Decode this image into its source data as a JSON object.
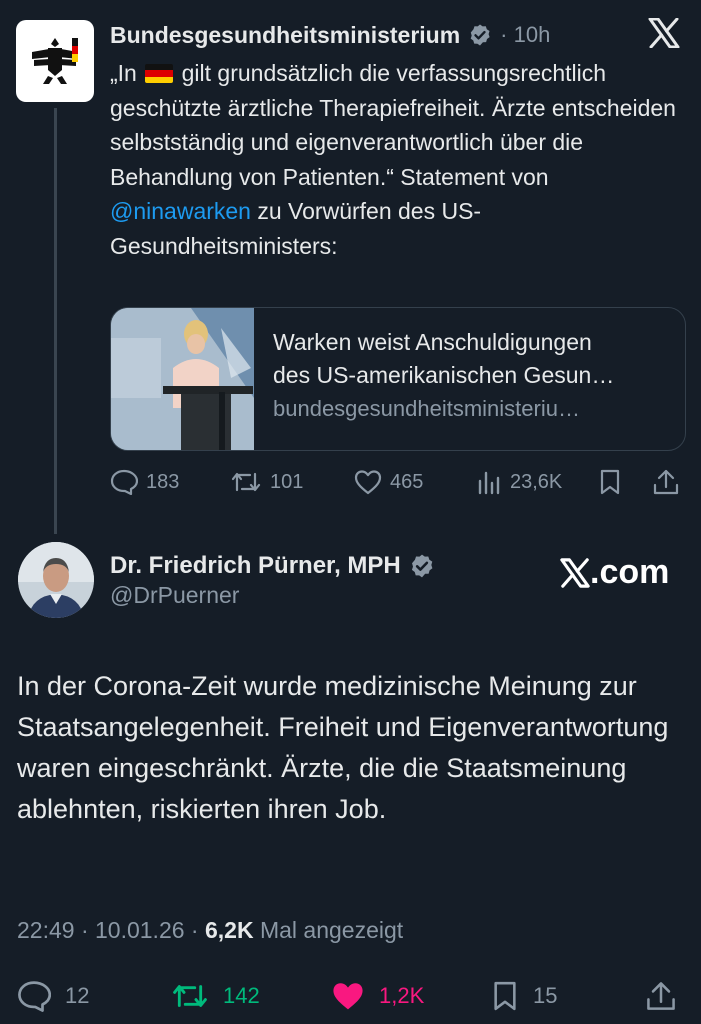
{
  "quoted": {
    "name": "Bundesgesundheitsministerium",
    "time": "· 10h",
    "text_a": "„In",
    "text_b": " gilt grundsätzlich die verfassungsrechtlich geschützte ärztliche Therapiefreiheit. Ärzte entscheiden selbstständig und eigenverantwortlich über die Behandlung von Patienten.“ Statement von ",
    "mention": "@ninawarken",
    "text_c": " zu Vorwürfen des US-Gesundheitsministers:",
    "card": {
      "title_line1": "Warken weist Anschuldigungen",
      "title_line2": "des US-amerikanischen Gesun…",
      "domain": "bundesgesundheitsministeriu…"
    },
    "stats": {
      "replies": "183",
      "reposts": "101",
      "likes": "465",
      "views": "23,6K"
    }
  },
  "main": {
    "name": "Dr. Friedrich Pürner, MPH",
    "handle": "@DrPuerner",
    "watermark": ".com",
    "text": "In der Corona-Zeit wurde medizinische Meinung zur Staatsangelegenheit. Freiheit und Eigenverantwortung waren eingeschränkt. Ärzte, die die Staatsmeinung ablehnten, riskierten ihren Job.",
    "meta_time": "22:49 · 10.01.26 · ",
    "meta_views": "6,2K",
    "meta_suffix": " Mal angezeigt",
    "stats": {
      "replies": "12",
      "reposts": "142",
      "likes": "1,2K",
      "bookmarks": "15"
    }
  },
  "colors": {
    "background": "#151d27",
    "mention": "#1d9bf0",
    "repost_active": "#00ba7c",
    "like_active": "#f91880",
    "verified": "#8b98a5"
  },
  "icons": [
    "eagle-logo-icon",
    "verified-icon",
    "x-logo-icon",
    "germany-flag-icon",
    "reply-icon",
    "repost-icon",
    "like-icon",
    "views-icon",
    "bookmark-icon",
    "share-icon"
  ]
}
